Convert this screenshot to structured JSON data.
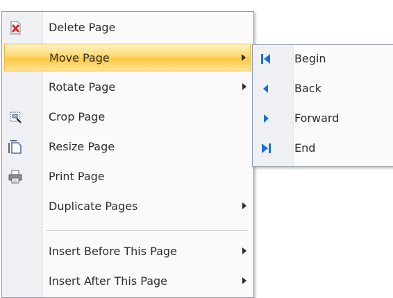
{
  "main_menu": {
    "items": [
      {
        "label": "Delete Page",
        "icon": "delete-page-icon",
        "submenu": false
      },
      {
        "label": "Move Page",
        "icon": null,
        "submenu": true,
        "highlighted": true
      },
      {
        "label": "Rotate Page",
        "icon": null,
        "submenu": true
      },
      {
        "label": "Crop Page",
        "icon": "crop-page-icon",
        "submenu": false
      },
      {
        "label": "Resize Page",
        "icon": "resize-page-icon",
        "submenu": false
      },
      {
        "label": "Print Page",
        "icon": "printer-icon",
        "submenu": false
      },
      {
        "label": "Duplicate Pages",
        "icon": null,
        "submenu": true
      },
      {
        "label": "Insert Before This Page",
        "icon": null,
        "submenu": true
      },
      {
        "label": "Insert After This Page",
        "icon": null,
        "submenu": true
      }
    ]
  },
  "submenu": {
    "items": [
      {
        "label": "Begin",
        "icon": "first-page-icon"
      },
      {
        "label": "Back",
        "icon": "back-arrow-icon"
      },
      {
        "label": "Forward",
        "icon": "forward-arrow-icon"
      },
      {
        "label": "End",
        "icon": "last-page-icon"
      }
    ]
  },
  "colors": {
    "highlight": "#ffd86e",
    "icon_blue": "#1a6fd6",
    "icon_red": "#d8262b"
  }
}
